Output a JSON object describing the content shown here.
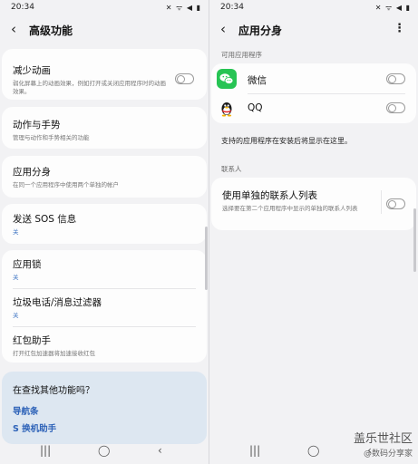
{
  "left": {
    "status": {
      "time": "20:34",
      "icons": "✕ ᯤ ◀ ▮"
    },
    "appbar": {
      "title": "高级功能"
    },
    "items": {
      "reduce_anim": {
        "title": "减少动画",
        "subtitle": "弱化屏幕上的动画效果，例如打开或关闭应用程序时的动画效果。"
      },
      "motion": {
        "title": "动作与手势",
        "subtitle": "管理与动作和手势相关的功能"
      },
      "dual_app": {
        "title": "应用分身",
        "subtitle": "在同一个应用程序中使用两个单独的帐户"
      },
      "sos": {
        "title": "发送 SOS 信息",
        "subtitle": "关"
      },
      "app_lock": {
        "title": "应用锁",
        "subtitle": "关"
      },
      "spam_filter": {
        "title": "垃圾电话/消息过滤器",
        "subtitle": "关"
      },
      "hongbao": {
        "title": "红包助手",
        "subtitle": "打开红包加速器将加速接收红包"
      }
    },
    "suggest": {
      "question": "在查找其他功能吗？",
      "link1": "导航条",
      "link2": "S 换机助手"
    },
    "nav": {
      "recents": "|||",
      "home": "◯",
      "back": "‹"
    }
  },
  "right": {
    "status": {
      "time": "20:34",
      "icons": "✕ ᯤ ◀ ▮"
    },
    "appbar": {
      "title": "应用分身",
      "more": "⋮"
    },
    "section_apps": "可用应用程序",
    "apps": [
      {
        "name": "微信",
        "icon": "wechat-icon",
        "color": "#27c454"
      },
      {
        "name": "QQ",
        "icon": "qq-penguin-icon"
      }
    ],
    "note": "支持的应用程序在安装后将显示在这里。",
    "section_contacts": "联系人",
    "contacts": {
      "title": "使用单独的联系人列表",
      "subtitle": "选择要在第二个应用程序中显示的单独的联系人列表"
    },
    "nav": {
      "recents": "|||",
      "home": "◯",
      "back": "‹"
    },
    "watermark": {
      "line1": "盖乐世社区",
      "line2": "@数码分享家"
    }
  }
}
